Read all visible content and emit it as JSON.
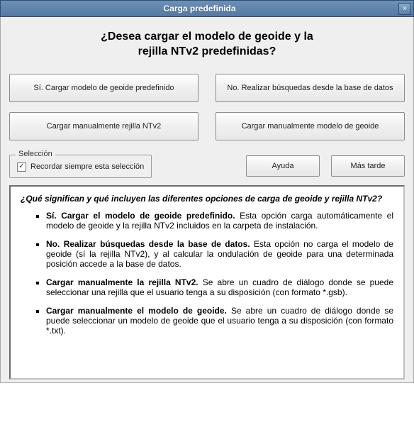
{
  "titlebar": {
    "title": "Carga predefinida",
    "close_icon": "×"
  },
  "heading": {
    "line1": "¿Desea cargar el modelo de geoide y la",
    "line2": "rejilla NTv2 predefinidas?"
  },
  "buttons": {
    "yes": "Sí. Cargar modelo de geoide predefinido",
    "no": "No. Realizar búsquedas desde la base de datos",
    "load_ntv2": "Cargar manualmente rejilla NTv2",
    "load_geoid": "Cargar manualmente modelo de geoide",
    "help": "Ayuda",
    "later": "Más tarde"
  },
  "selection": {
    "legend": "Selección",
    "remember": "Recordar siempre esta selección",
    "checked": "✓"
  },
  "info": {
    "heading": "¿Qué significan y qué incluyen las diferentes opciones de carga de geoide y rejilla NTv2?",
    "items": [
      {
        "title": "Sí. Cargar el modelo de geoide predefinido.",
        "text": " Esta opción carga automáticamente el modelo de geoide y la rejilla NTv2 incluidos en la carpeta de instalación."
      },
      {
        "title": "No. Realizar búsquedas desde la base de datos.",
        "text": " Esta opción no carga el modelo de geoide (sí la rejilla NTv2), y al calcular la ondulación de geoide para una determinada posición accede a la base de datos."
      },
      {
        "title": "Cargar manualmente la rejilla NTv2.",
        "text": " Se abre un cuadro de diálogo donde se puede seleccionar una rejilla que el usuario tenga a su disposición (con formato *.gsb)."
      },
      {
        "title": "Cargar manualmente el modelo de geoide.",
        "text": " Se abre un cuadro de diálogo donde se puede seleccionar un modelo de geoide que el usuario tenga a su disposición (con formato *.txt)."
      }
    ]
  }
}
